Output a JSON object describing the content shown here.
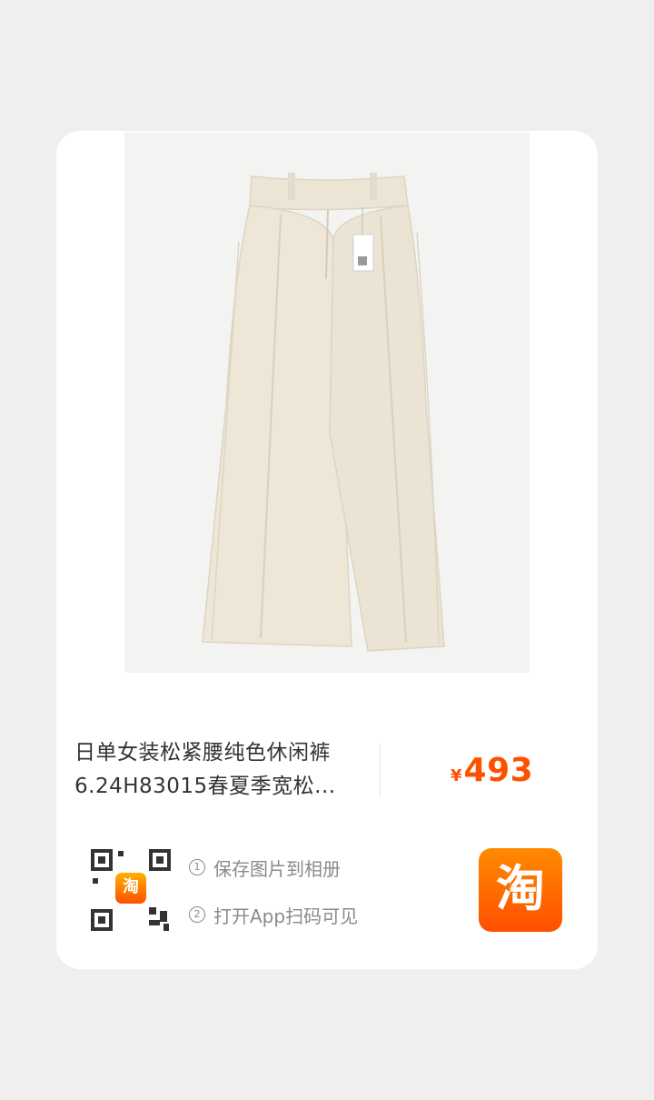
{
  "product": {
    "title_line1": "日单女装松紧腰纯色休闲裤",
    "title_line2": "6.24H83015春夏季宽松...",
    "price_symbol": "¥",
    "price": "493"
  },
  "share": {
    "step1_num": "1",
    "step1_text": "保存图片到相册",
    "step2_num": "2",
    "step2_text": "打开App扫码可见",
    "qr_logo_glyph": "淘",
    "taobao_glyph": "淘"
  },
  "colors": {
    "accent": "#ff5000",
    "card_bg": "#ffffff",
    "page_bg": "#efefef"
  },
  "icons": [
    "qr-code-icon",
    "taobao-app-icon"
  ]
}
